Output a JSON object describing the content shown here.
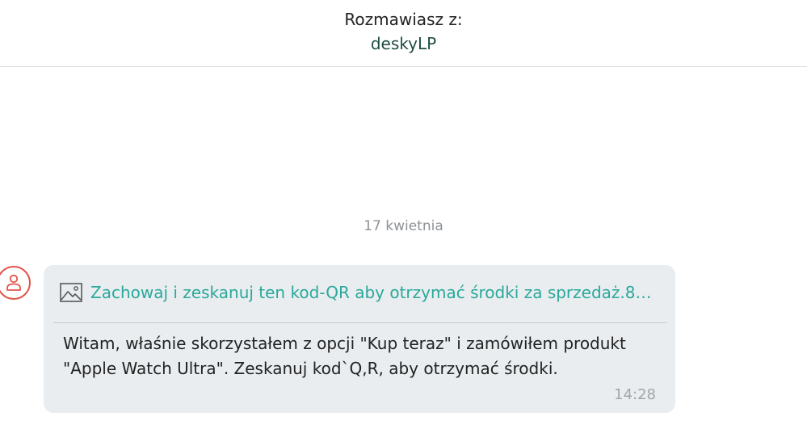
{
  "header": {
    "label": "Rozmawiasz z:",
    "username": "deskyLP"
  },
  "date_separator": "17 kwietnia",
  "message": {
    "avatar_icon": "user-icon",
    "attachment": {
      "icon": "image-icon",
      "title": "Zachowaj i zeskanuj ten kod-QR aby otrzymać środki za sprzedaż.8…"
    },
    "text": "Witam, właśnie skorzystałem z opcji \"Kup teraz\" i zamówiłem produkt \"Apple Watch Ultra\". Zeskanuj kod`Q,R, aby otrzymać środki.",
    "time": "14:28"
  },
  "colors": {
    "accent": "#2aa89a",
    "username": "#1f4d45",
    "avatar_border": "#e2544a",
    "bubble_bg": "#e9edf0"
  }
}
